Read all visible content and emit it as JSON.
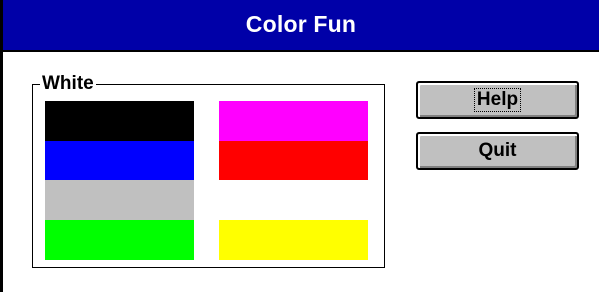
{
  "window": {
    "title": "Color Fun",
    "title_bar_color": "#0000a8"
  },
  "group": {
    "label": "White"
  },
  "swatches": [
    {
      "name": "black",
      "color": "#000000"
    },
    {
      "name": "blue",
      "color": "#0000ff"
    },
    {
      "name": "gray",
      "color": "#c0c0c0"
    },
    {
      "name": "green",
      "color": "#00ff00"
    },
    {
      "name": "magenta",
      "color": "#ff00ff"
    },
    {
      "name": "red",
      "color": "#ff0000"
    },
    {
      "name": "white",
      "color": "#ffffff"
    },
    {
      "name": "yellow",
      "color": "#ffff00"
    }
  ],
  "buttons": {
    "help_label": "Help",
    "quit_label": "Quit"
  }
}
